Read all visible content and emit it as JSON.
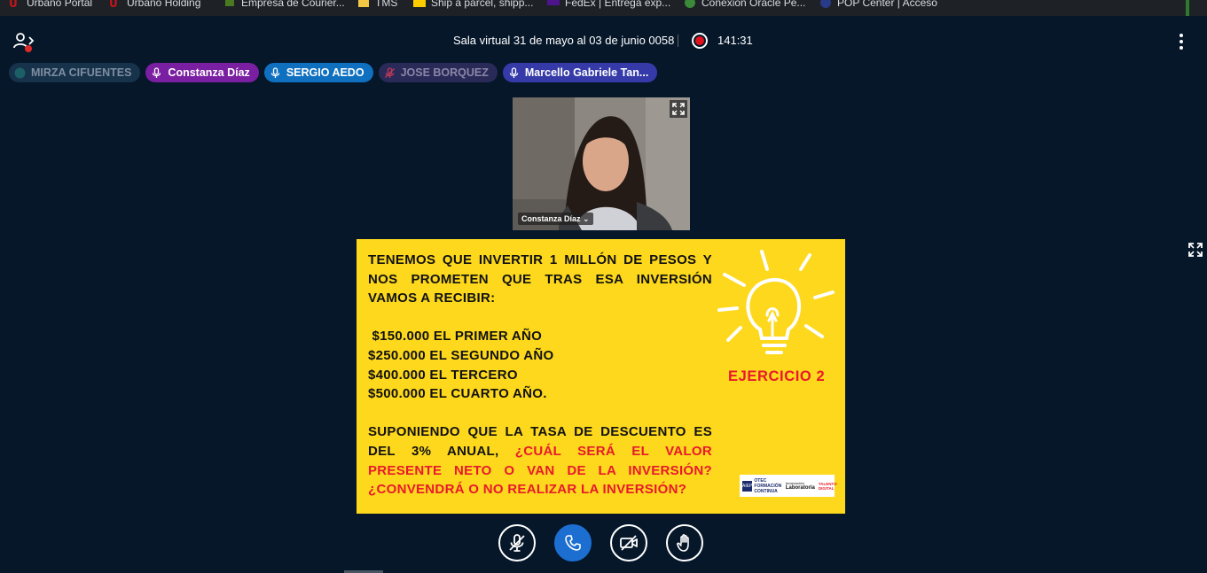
{
  "bookmarks": [
    {
      "label": "Urbano Portal",
      "icon": "urbano-logo-icon",
      "color": "#c4161c"
    },
    {
      "label": "Urbano Holding",
      "icon": "urbano-logo-icon",
      "color": "#c4161c"
    },
    {
      "label": "Empresa de Courier...",
      "icon": "courier-logo-icon",
      "color": "#4a7a1f"
    },
    {
      "label": "TMS",
      "icon": "folder-icon",
      "color": "#f2c744"
    },
    {
      "label": "Ship a parcel, shipp...",
      "icon": "dhl-logo-icon",
      "color": "#ffcc00"
    },
    {
      "label": "FedEx | Entrega exp...",
      "icon": "fedex-logo-icon",
      "color": "#4d148c"
    },
    {
      "label": "Conexión Oracle Pe...",
      "icon": "oracle-globe-icon",
      "color": "#3a8a3a"
    },
    {
      "label": "POP Center | Acceso",
      "icon": "pop-logo-icon",
      "color": "#2a3a8a"
    }
  ],
  "header": {
    "room_title": "Sala virtual 31 de mayo al 03 de junio 0058",
    "recording_time": "141:31",
    "recording_color": "#e0121e"
  },
  "participants": [
    {
      "name": "MIRZA CIFUENTES",
      "state": "listen-only"
    },
    {
      "name": "Constanza Díaz",
      "state": "mic-on"
    },
    {
      "name": "SERGIO AEDO",
      "state": "mic-on"
    },
    {
      "name": "JOSE BORQUEZ",
      "state": "mic-muted"
    },
    {
      "name": "Marcello Gabriele Tan...",
      "state": "mic-on"
    }
  ],
  "video": {
    "name": "Constanza Díaz ⌄"
  },
  "slide": {
    "intro": "TENEMOS QUE INVERTIR 1 MILLÓN DE PESOS Y NOS PROMETEN QUE TRAS ESA INVERSIÓN VAMOS A RECIBIR:",
    "amounts": [
      " $150.000 EL PRIMER AÑO",
      "$250.000 EL SEGUNDO AÑO",
      "$400.000 EL TERCERO",
      "$500.000 EL CUARTO AÑO."
    ],
    "question_black": "SUPONIENDO QUE LA TASA DE DESCUENTO ES DEL 3% ANUAL,",
    "question_red": "¿CUÁL SERÁ EL VALOR PRESENTE NETO O VAN DE LA INVERSIÓN? ¿CONVENDRÁ O NO REALIZAR LA INVERSIÓN?",
    "badge": "EJERCICIO 2",
    "background_color": "#fdd81c",
    "accent_color": "#e8192c",
    "logos": {
      "otec_mark": "AIEP",
      "otec": "OTEC",
      "otec_sub": "FORMACIÓN CONTINUA",
      "lab_prefix": "Innovación",
      "lab": "Laboratoria",
      "talento": "TALENTO DIGITAL"
    }
  },
  "controls": {
    "mute_icon": "mic-muted-icon",
    "call_icon": "phone-icon",
    "video_icon": "video-off-icon",
    "hand_icon": "raise-hand-icon"
  }
}
